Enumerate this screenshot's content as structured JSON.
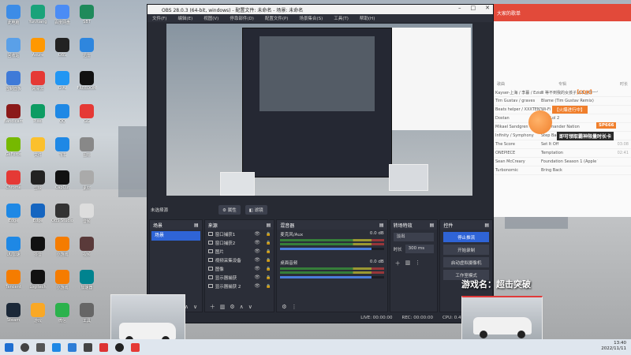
{
  "desktop": {
    "icons": [
      {
        "label": "此电脑",
        "color": "#3c8ce7"
      },
      {
        "label": "YunXiang",
        "color": "#1aa37a"
      },
      {
        "label": "百度网盘",
        "color": "#4b8cf5"
      },
      {
        "label": "SBT",
        "color": "#1f8a5b"
      },
      {
        "label": "回收站",
        "color": "#5aa0e8"
      },
      {
        "label": "Axure",
        "color": "#ff9800"
      },
      {
        "label": "OBS",
        "color": "#222"
      },
      {
        "label": "迅雷",
        "color": "#2e86de"
      },
      {
        "label": "控制面板",
        "color": "#3f7ad8"
      },
      {
        "label": "网易云",
        "color": "#e53935"
      },
      {
        "label": "G-AI",
        "color": "#2196f3"
      },
      {
        "label": "FREEDOM",
        "color": "#111"
      },
      {
        "label": "Bandicam",
        "color": "#8b1a1a"
      },
      {
        "label": "Pixel",
        "color": "#0d9c63"
      },
      {
        "label": "QQ",
        "color": "#1e88e5"
      },
      {
        "label": "GG",
        "color": "#e53935"
      },
      {
        "label": "GeForce",
        "color": "#76b900"
      },
      {
        "label": "文件",
        "color": "#fbc02d"
      },
      {
        "label": "飞书",
        "color": "#1e88e5"
      },
      {
        "label": "图标",
        "color": "#888"
      },
      {
        "label": "Chrome",
        "color": "#e53935"
      },
      {
        "label": "剪映",
        "color": "#222"
      },
      {
        "label": "CapCut",
        "color": "#111"
      },
      {
        "label": "素材",
        "color": "#aaa"
      },
      {
        "label": "Edge",
        "color": "#1e88e5"
      },
      {
        "label": "Edge",
        "color": "#1565c0"
      },
      {
        "label": "OBS Studio",
        "color": "#333"
      },
      {
        "label": "音频",
        "color": "#ddd"
      },
      {
        "label": "UU加速",
        "color": "#1e88e5"
      },
      {
        "label": "抖音",
        "color": "#111"
      },
      {
        "label": "小游戏",
        "color": "#f57c00"
      },
      {
        "label": "视频",
        "color": "#5a3a3a"
      },
      {
        "label": "Tencent",
        "color": "#f57c00"
      },
      {
        "label": "Logitech",
        "color": "#111"
      },
      {
        "label": "小游戏",
        "color": "#f57c00"
      },
      {
        "label": "加速器",
        "color": "#00838f"
      },
      {
        "label": "Steam",
        "color": "#1b2838"
      },
      {
        "label": "游戏",
        "color": "#f9a825"
      },
      {
        "label": "微信",
        "color": "#2bb24c"
      },
      {
        "label": "工具",
        "color": "#666"
      }
    ]
  },
  "obs": {
    "title": "OBS 28.0.3 (64-bit, windows) - 配置文件: 未命名 - 场景: 未命名",
    "menu": [
      "文件(F)",
      "编辑(E)",
      "视图(V)",
      "停靠部件(D)",
      "配置文件(P)",
      "场景集合(S)",
      "工具(T)",
      "帮助(H)"
    ],
    "no_source": "未选择源",
    "props_btn": "属性",
    "filters_btn": "滤镜",
    "scenes": {
      "header": "场景",
      "items": [
        "场景"
      ]
    },
    "sources": {
      "header": "来源",
      "items": [
        "窗口捕获1",
        "窗口捕获2",
        "图片",
        "视频采集设备",
        "图像",
        "显示器捕获",
        "显示器捕获 2"
      ]
    },
    "mixer": {
      "header": "混音器",
      "channels": [
        {
          "name": "麦克风/Aux",
          "db": "0.0 dB"
        },
        {
          "name": "桌面音频",
          "db": "0.0 dB"
        }
      ]
    },
    "transitions": {
      "header": "转场特效",
      "selected": "淡出",
      "duration_label": "时长",
      "duration": "300 ms"
    },
    "controls": {
      "header": "控件",
      "buttons": [
        "停止推流",
        "开始录制",
        "启动虚拟摄像机",
        "工作室模式"
      ]
    },
    "status": {
      "live": "LIVE: 00:00:00",
      "rec": "REC: 00:00:00",
      "cpu": "CPU: 0.4%, 60.00 fps"
    }
  },
  "right_app": {
    "header": "大家的歌单",
    "col_song": "歌曲",
    "col_artist": "专辑",
    "col_time": "时长",
    "tracks": [
      {
        "song": "Kayser-上海 / 李暮 / Ezio",
        "artist": "Ⅲ 等不到我的女孩子又不止你一个",
        "time": ""
      },
      {
        "song": "Tim Gustav / graves",
        "artist": "Blame (Tim Gustav Remix)",
        "time": ""
      },
      {
        "song": "Beats helper / XXXTENTACION",
        "artist": "Wi-Fi",
        "time": ""
      },
      {
        "song": "Dostan",
        "artist": "Bed Lol 2",
        "time": ""
      },
      {
        "song": "Mikael Sandgren",
        "artist": "Commander Nation",
        "time": ""
      },
      {
        "song": "Infinity / Symphony",
        "artist": "Step Back!",
        "time": ""
      },
      {
        "song": "The Score",
        "artist": "Set It Off",
        "time": "03:08"
      },
      {
        "song": "ONEPIECE",
        "artist": "Temptation",
        "time": "02:41"
      },
      {
        "song": "Sean McCreary",
        "artist": "Foundation Season 1 (Apple TV+)",
        "time": ""
      },
      {
        "song": "Turbonomic",
        "artist": "Bring Back",
        "time": ""
      }
    ]
  },
  "promo": {
    "tag": "【火爆进行中】",
    "cdk": "【CDK】",
    "sp": "SP666",
    "line": "即可领取霸神限量时长卡"
  },
  "overlay": {
    "game_caption": "游戏名：超击突破"
  },
  "taskbar": {
    "time": "13:40",
    "date": "2022/11/11"
  }
}
